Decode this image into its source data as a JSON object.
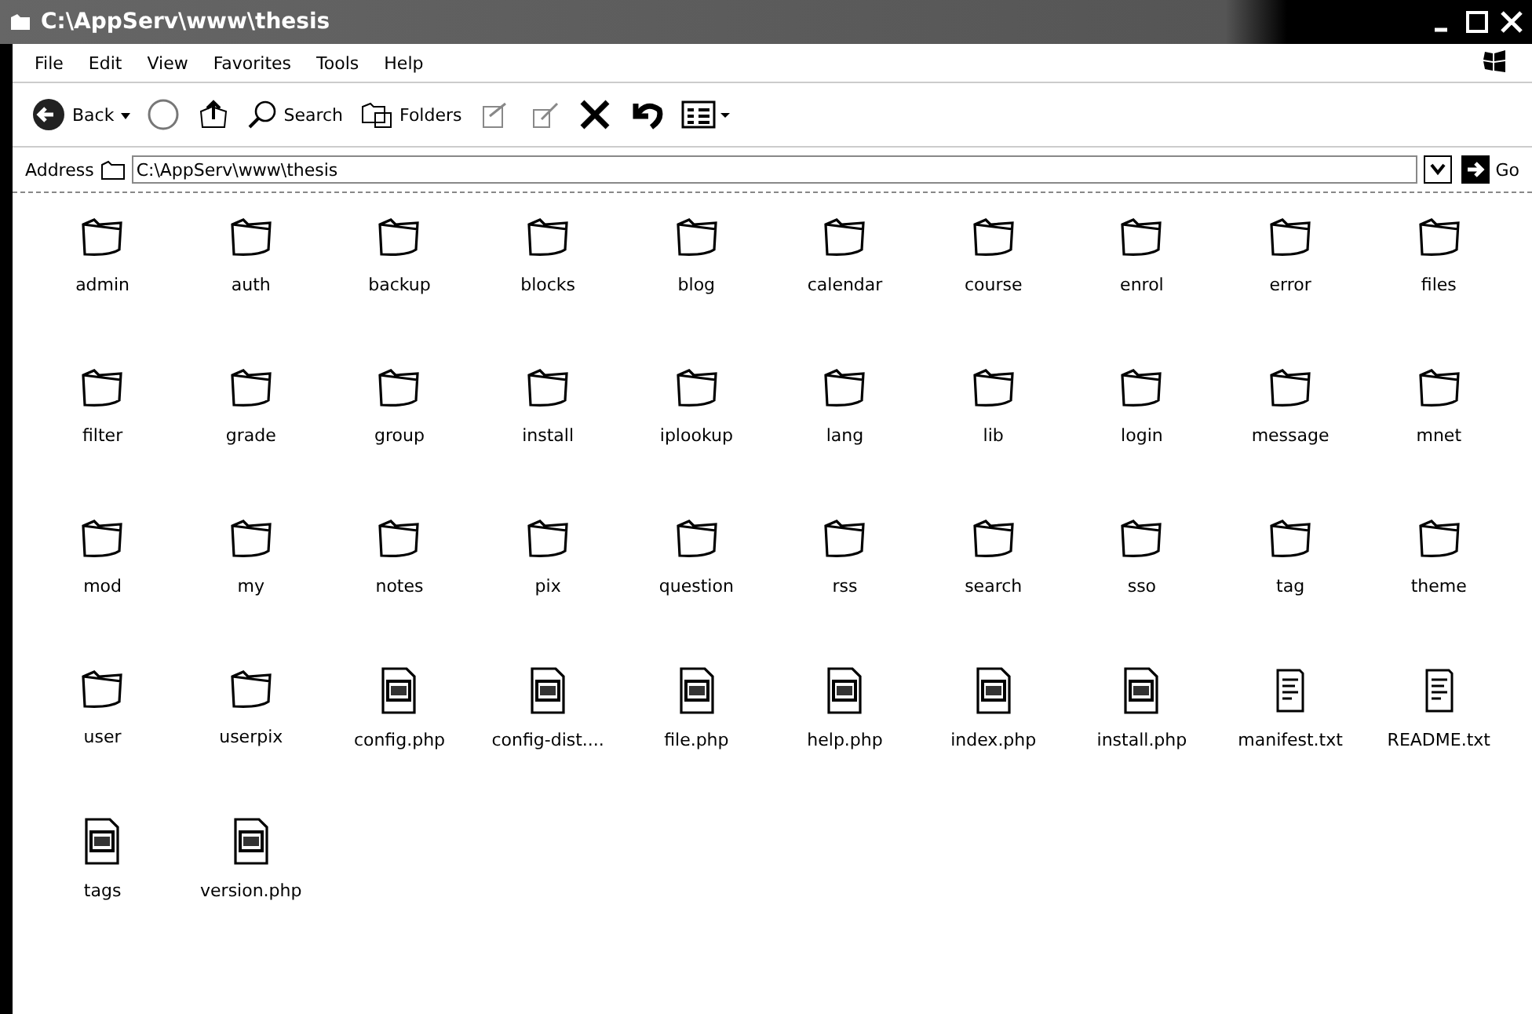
{
  "window": {
    "title": "C:\\AppServ\\www\\thesis"
  },
  "menu": [
    {
      "label": "File"
    },
    {
      "label": "Edit"
    },
    {
      "label": "View"
    },
    {
      "label": "Favorites"
    },
    {
      "label": "Tools"
    },
    {
      "label": "Help"
    }
  ],
  "toolbar": [
    {
      "kind": "back",
      "label": "Back"
    },
    {
      "kind": "forward"
    },
    {
      "kind": "up"
    },
    {
      "kind": "search",
      "label": "Search"
    },
    {
      "kind": "folders",
      "label": "Folders"
    },
    {
      "kind": "move"
    },
    {
      "kind": "copy"
    },
    {
      "kind": "delete"
    },
    {
      "kind": "undo"
    },
    {
      "kind": "views"
    }
  ],
  "address": {
    "label": "Address",
    "value": "C:\\AppServ\\www\\thesis",
    "go": "Go"
  },
  "items": [
    {
      "name": "admin",
      "kind": "folder"
    },
    {
      "name": "auth",
      "kind": "folder"
    },
    {
      "name": "backup",
      "kind": "folder"
    },
    {
      "name": "blocks",
      "kind": "folder"
    },
    {
      "name": "blog",
      "kind": "folder"
    },
    {
      "name": "calendar",
      "kind": "folder"
    },
    {
      "name": "course",
      "kind": "folder"
    },
    {
      "name": "enrol",
      "kind": "folder"
    },
    {
      "name": "error",
      "kind": "folder"
    },
    {
      "name": "files",
      "kind": "folder"
    },
    {
      "name": "filter",
      "kind": "folder"
    },
    {
      "name": "grade",
      "kind": "folder"
    },
    {
      "name": "group",
      "kind": "folder"
    },
    {
      "name": "install",
      "kind": "folder"
    },
    {
      "name": "iplookup",
      "kind": "folder"
    },
    {
      "name": "lang",
      "kind": "folder"
    },
    {
      "name": "lib",
      "kind": "folder"
    },
    {
      "name": "login",
      "kind": "folder"
    },
    {
      "name": "message",
      "kind": "folder"
    },
    {
      "name": "mnet",
      "kind": "folder"
    },
    {
      "name": "mod",
      "kind": "folder"
    },
    {
      "name": "my",
      "kind": "folder"
    },
    {
      "name": "notes",
      "kind": "folder"
    },
    {
      "name": "pix",
      "kind": "folder"
    },
    {
      "name": "question",
      "kind": "folder"
    },
    {
      "name": "rss",
      "kind": "folder"
    },
    {
      "name": "search",
      "kind": "folder"
    },
    {
      "name": "sso",
      "kind": "folder"
    },
    {
      "name": "tag",
      "kind": "folder"
    },
    {
      "name": "theme",
      "kind": "folder"
    },
    {
      "name": "user",
      "kind": "folder"
    },
    {
      "name": "userpix",
      "kind": "folder"
    },
    {
      "name": "config.php",
      "kind": "php"
    },
    {
      "name": "config-dist....",
      "kind": "php"
    },
    {
      "name": "file.php",
      "kind": "php"
    },
    {
      "name": "help.php",
      "kind": "php"
    },
    {
      "name": "index.php",
      "kind": "php"
    },
    {
      "name": "install.php",
      "kind": "php"
    },
    {
      "name": "manifest.txt",
      "kind": "txt"
    },
    {
      "name": "README.txt",
      "kind": "txt"
    },
    {
      "name": "tags",
      "kind": "php"
    },
    {
      "name": "version.php",
      "kind": "php"
    }
  ]
}
